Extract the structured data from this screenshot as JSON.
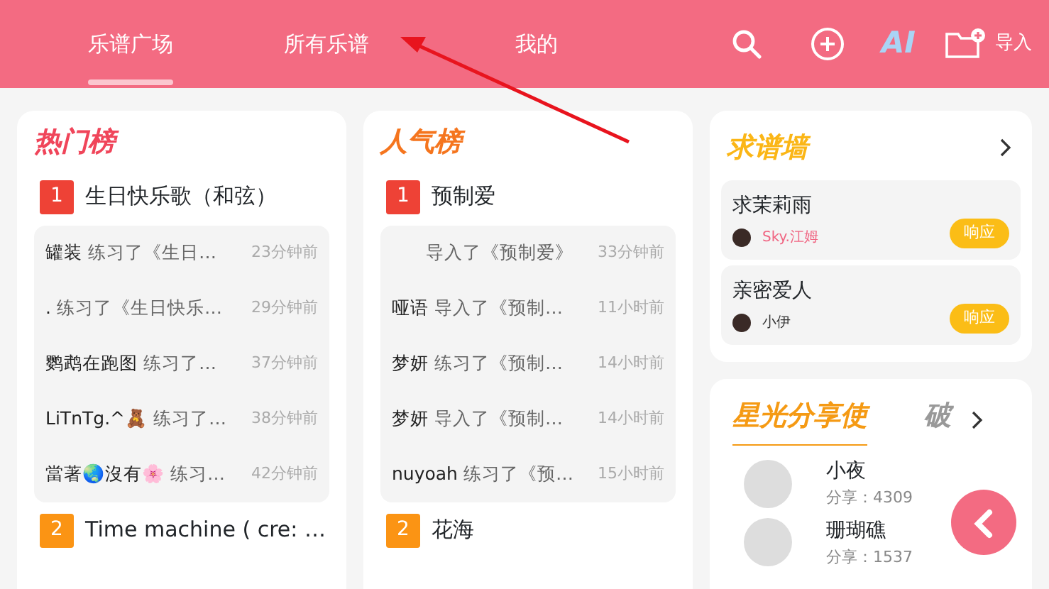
{
  "tabs": [
    {
      "label": "乐谱广场",
      "selected": true
    },
    {
      "label": "所有乐谱",
      "selected": false
    },
    {
      "label": "我的",
      "selected": false
    }
  ],
  "toolbar": {
    "ai_label": "AI",
    "import_label": "导入"
  },
  "boards": [
    {
      "title": "热门榜",
      "color": "#f0455a",
      "entries": [
        {
          "rank": "1",
          "color": "#ee4236",
          "title": "生日快乐歌（和弦）",
          "activity": [
            {
              "user": "罐装",
              "action": "练习了《生日…",
              "time": "23分钟前"
            },
            {
              "user": ".",
              "action": "练习了《生日快乐…",
              "time": "29分钟前"
            },
            {
              "user": "鹦鹉在跑图",
              "action": "练习了…",
              "time": "37分钟前"
            },
            {
              "user": "LiTnTg.^🧸",
              "action": "练习了…",
              "time": "38分钟前"
            },
            {
              "user": "當著🌏沒有🌸",
              "action": "练习…",
              "time": "42分钟前"
            }
          ]
        },
        {
          "rank": "2",
          "color": "#fb9414",
          "title": "Time machine ( cre: …"
        }
      ]
    },
    {
      "title": "人气榜",
      "color": "#f5751e",
      "entries": [
        {
          "rank": "1",
          "color": "#ee4236",
          "title": "预制爱",
          "activity": [
            {
              "action": "导入了《预制爱》",
              "time": "33分钟前"
            },
            {
              "user": "哑语",
              "action": "导入了《预制…",
              "time": "11小时前"
            },
            {
              "user": "梦妍",
              "action": "练习了《预制…",
              "time": "14小时前"
            },
            {
              "user": "梦妍",
              "action": "导入了《预制…",
              "time": "14小时前"
            },
            {
              "user": "nuyoah",
              "action": "练习了《预…",
              "time": "15小时前"
            }
          ]
        },
        {
          "rank": "2",
          "color": "#fb9414",
          "title": "花海"
        }
      ]
    }
  ],
  "request_wall": {
    "title": "求谱墙",
    "items": [
      {
        "title": "求茉莉雨",
        "user": "Sky.江姆",
        "color": "#f06582",
        "button": "响应"
      },
      {
        "title": "亲密爱人",
        "user": "小伊",
        "color": "#333333",
        "button": "响应"
      }
    ]
  },
  "sharers": {
    "tabs": [
      {
        "label": "星光分享使",
        "selected": true
      },
      {
        "label": "破",
        "selected": false
      }
    ],
    "items": [
      {
        "name": "小夜",
        "count": "分享：4309"
      },
      {
        "name": "珊瑚礁",
        "count": "分享：1537"
      }
    ]
  }
}
